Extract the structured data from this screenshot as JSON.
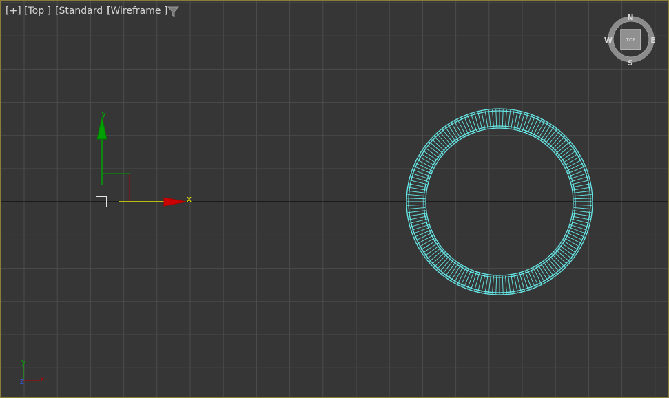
{
  "viewport": {
    "menu_label": "[+]",
    "view_label": "[Top ]",
    "shading_label": "[Standard ]",
    "display_mode_label": "[Wireframe ]",
    "filter_icon": "funnel-icon",
    "border_color": "#8a7d3c",
    "background_color": "#363636",
    "grid_color": "#4c4c4c",
    "home_grid_axis_color": "#000000"
  },
  "viewcube": {
    "face_label": "TOP",
    "compass": {
      "north": "N",
      "south": "S",
      "east": "E",
      "west": "W"
    }
  },
  "gizmo": {
    "x_label": "x",
    "y_label": "y",
    "x_axis_color": "#e8e800",
    "x_arrow_color": "#cc0000",
    "y_axis_color": "#00a000",
    "y_arrow_color": "#007800",
    "plane_color_x": "#a00000",
    "plane_color_y": "#00a000"
  },
  "world_axis": {
    "x_label": "x",
    "y_label": "y",
    "z_label": "z"
  },
  "object": {
    "type": "tube",
    "selection_color": "#67e7e7",
    "segments": 160
  }
}
